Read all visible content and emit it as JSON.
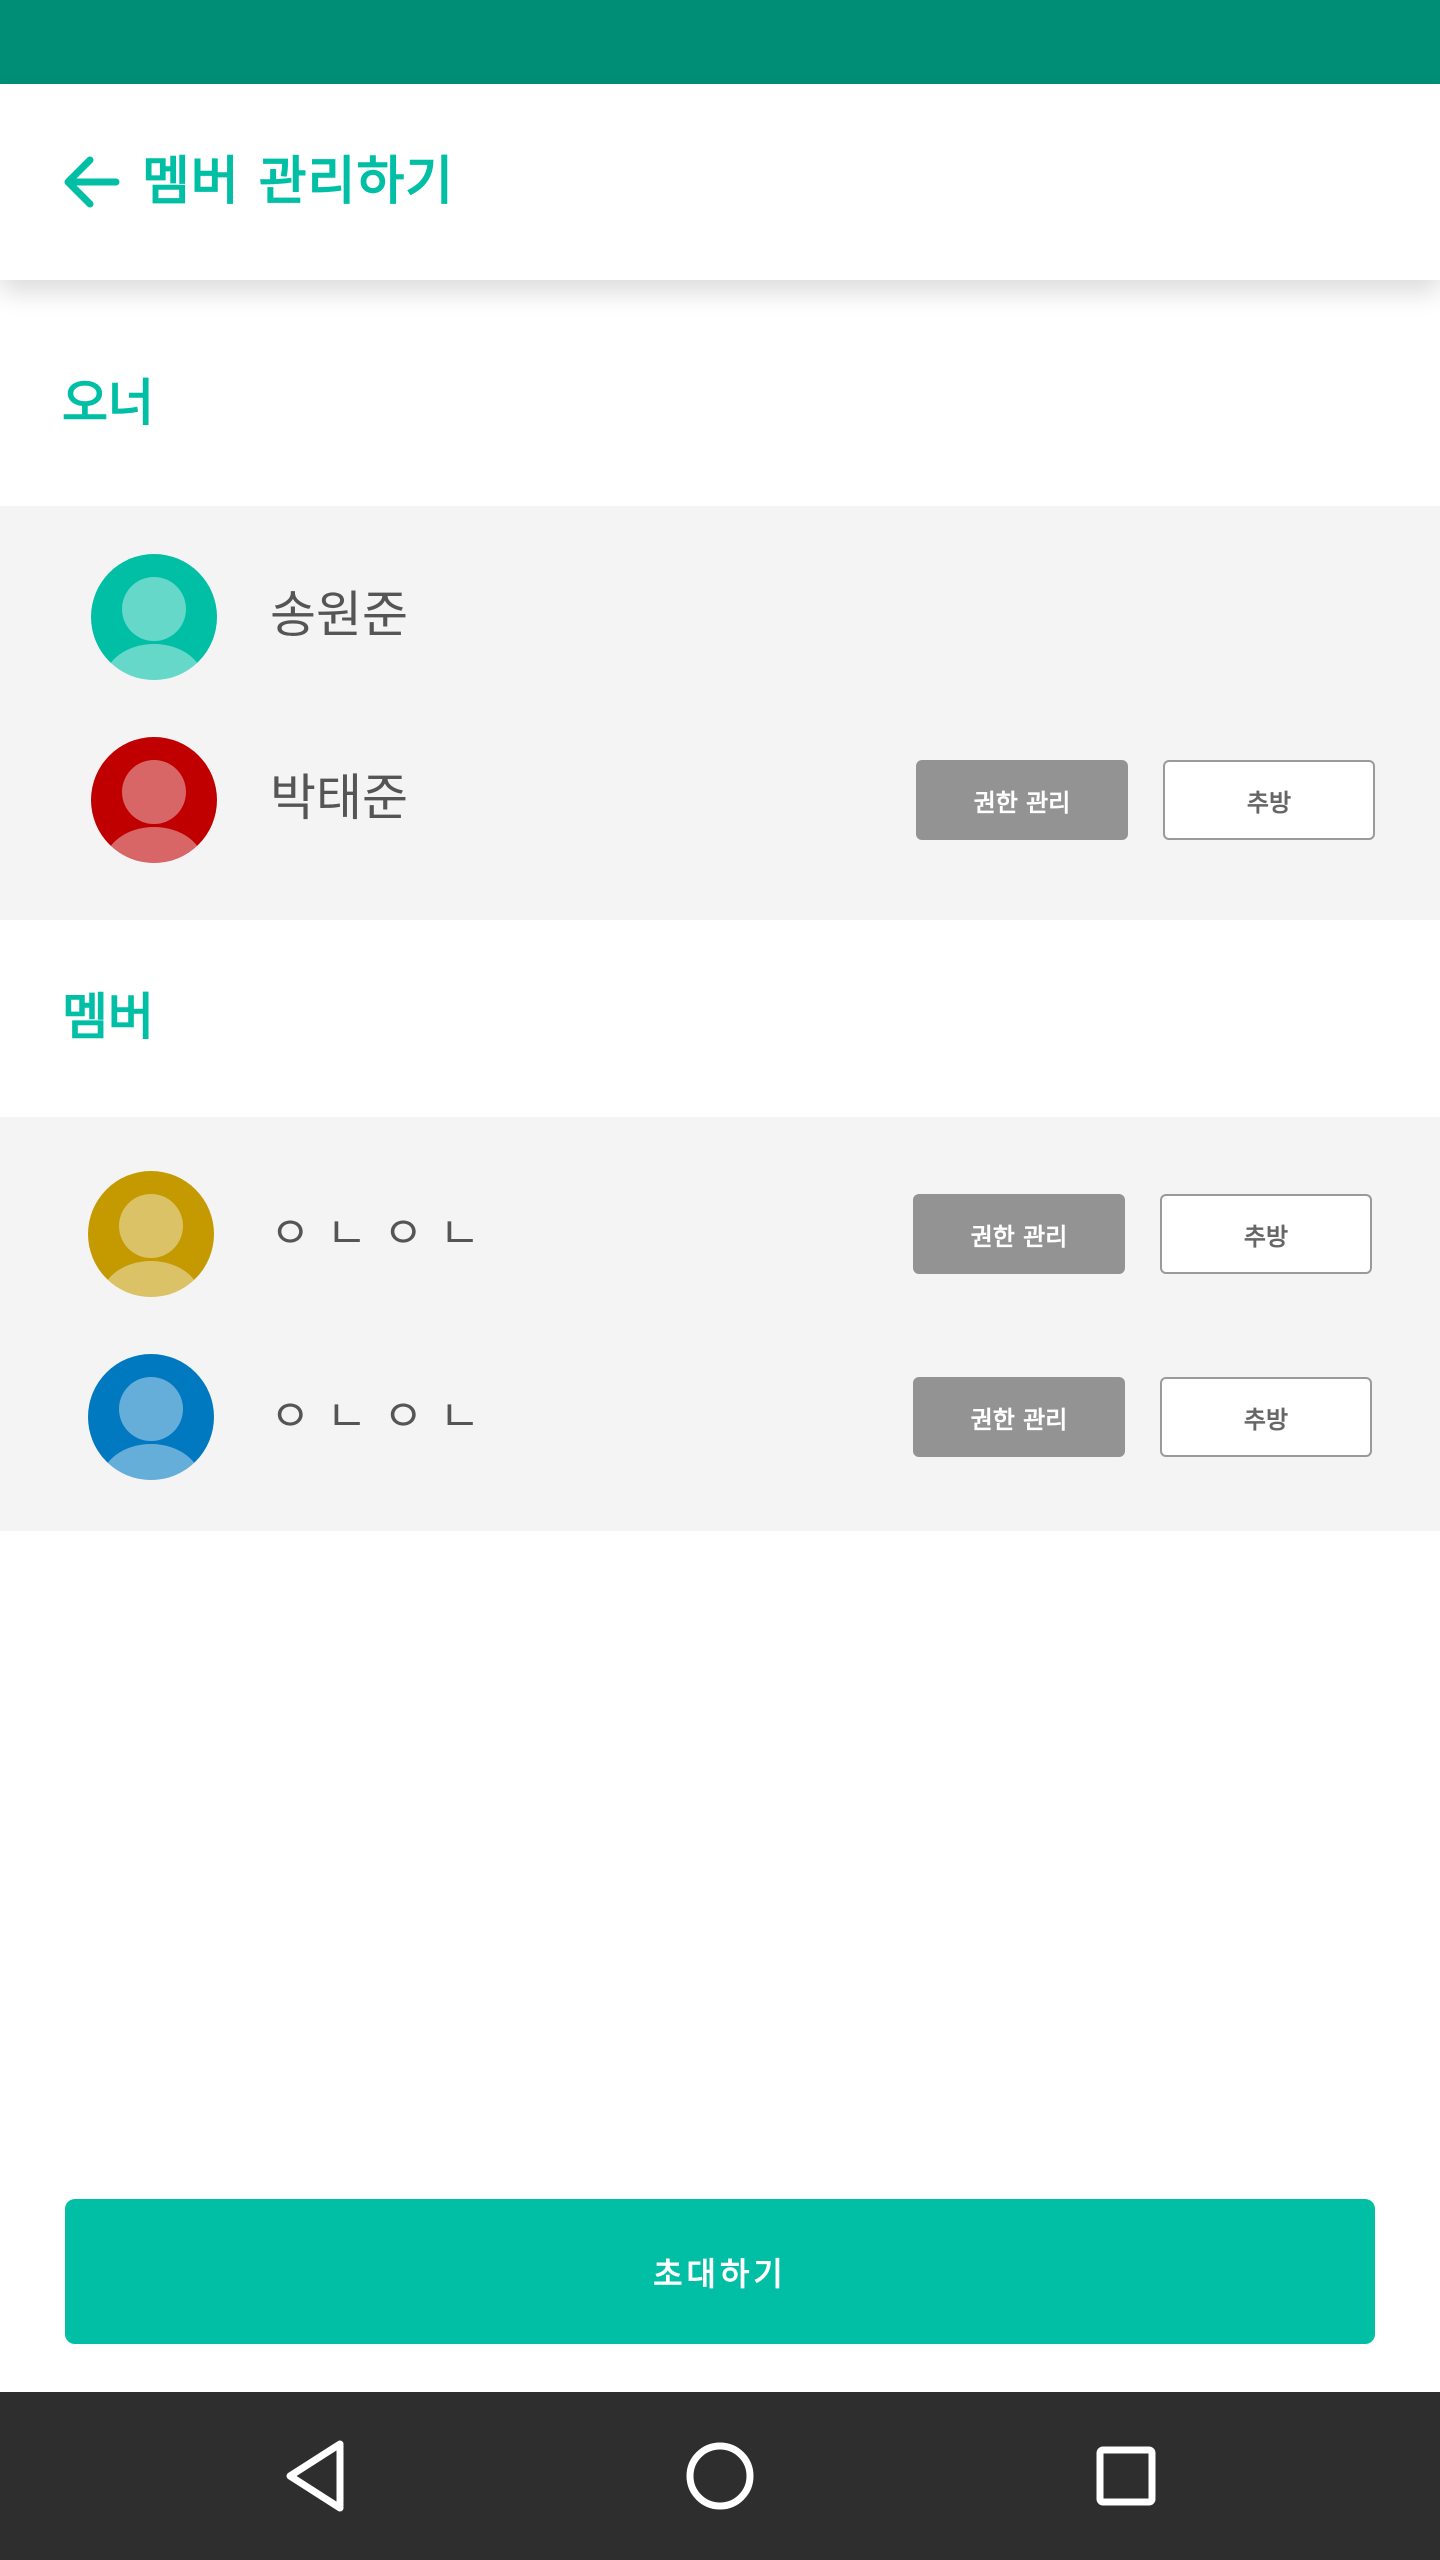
{
  "header": {
    "title": "멤버 관리하기",
    "back_icon": "arrow-left-icon"
  },
  "owners": {
    "label": "오너",
    "members": [
      {
        "name": "송원준",
        "avatar_color": "#00bfa5",
        "show_actions": false
      },
      {
        "name": "박태준",
        "avatar_color": "#c00000",
        "show_actions": true,
        "perm_label": "권한 관리",
        "kick_label": "추방"
      }
    ]
  },
  "members": {
    "label": "멤버",
    "members": [
      {
        "name": "ㅇㄴㅇㄴ",
        "avatar_color": "#c49a00",
        "perm_label": "권한 관리",
        "kick_label": "추방"
      },
      {
        "name": "ㅇㄴㅇㄴ",
        "avatar_color": "#0079c1",
        "perm_label": "권한 관리",
        "kick_label": "추방"
      }
    ]
  },
  "invite_button": {
    "label": "초대하기"
  },
  "nav": {
    "back": "triangle-back-icon",
    "home": "circle-home-icon",
    "recents": "square-recents-icon"
  },
  "colors": {
    "accent": "#00bfa5",
    "status_bar": "#008e76",
    "button_gray": "#939393",
    "nav_bar": "#2e2e2e"
  }
}
